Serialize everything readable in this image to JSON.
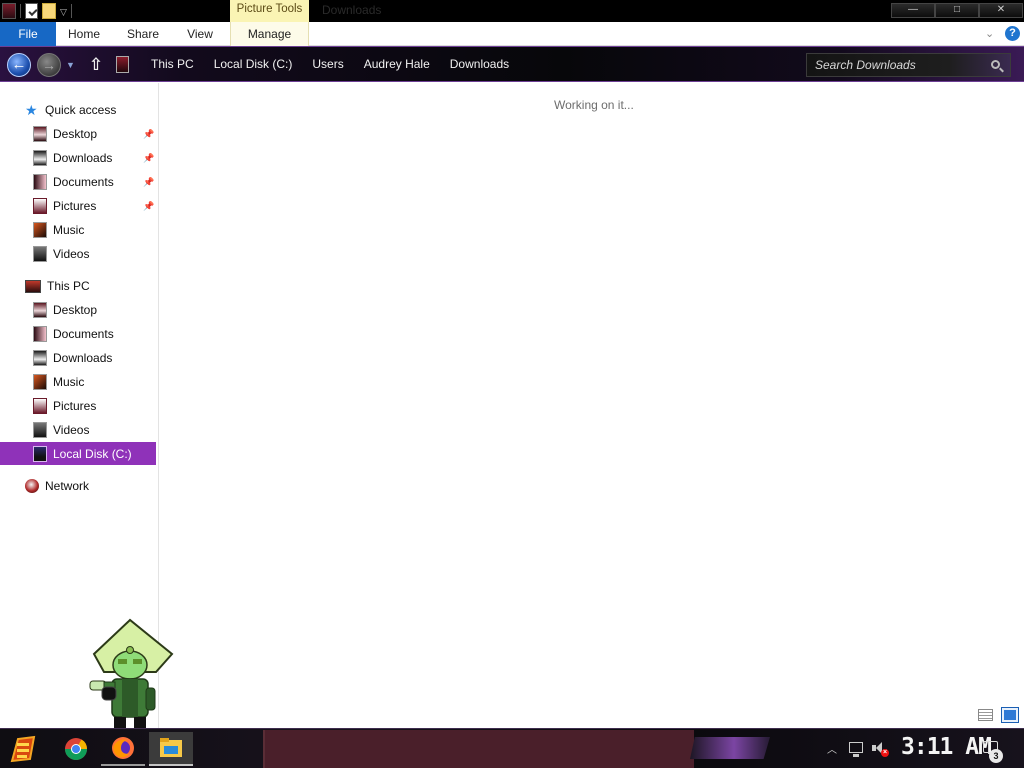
{
  "window": {
    "title": "Downloads",
    "contextual_group": "Picture Tools",
    "controls": {
      "minimize": "—",
      "maximize": "□",
      "close": "✕"
    }
  },
  "ribbon": {
    "tabs": [
      {
        "label": "File"
      },
      {
        "label": "Home"
      },
      {
        "label": "Share"
      },
      {
        "label": "View"
      },
      {
        "label": "Manage"
      }
    ],
    "help": "?"
  },
  "address": {
    "breadcrumbs": [
      "This PC",
      "Local Disk (C:)",
      "Users",
      "Audrey Hale",
      "Downloads"
    ],
    "search_placeholder": "Search Downloads"
  },
  "sidebar": {
    "quick_access": {
      "label": "Quick access",
      "items": [
        {
          "label": "Desktop",
          "icon": "desktop-icon",
          "pinned": true
        },
        {
          "label": "Downloads",
          "icon": "downloads-icon",
          "pinned": true
        },
        {
          "label": "Documents",
          "icon": "documents-icon",
          "pinned": true
        },
        {
          "label": "Pictures",
          "icon": "pictures-icon",
          "pinned": true
        },
        {
          "label": "Music",
          "icon": "music-icon",
          "pinned": false
        },
        {
          "label": "Videos",
          "icon": "videos-icon",
          "pinned": false
        }
      ]
    },
    "this_pc": {
      "label": "This PC",
      "items": [
        {
          "label": "Desktop"
        },
        {
          "label": "Documents"
        },
        {
          "label": "Downloads"
        },
        {
          "label": "Music"
        },
        {
          "label": "Pictures"
        },
        {
          "label": "Videos"
        },
        {
          "label": "Local Disk (C:)",
          "selected": true
        }
      ]
    },
    "network": {
      "label": "Network"
    }
  },
  "content": {
    "status": "Working on it..."
  },
  "taskbar": {
    "clock": "3:11 AM",
    "notification_count": "3",
    "pinned_apps": [
      "chrome-icon",
      "firefox-icon",
      "file-explorer-icon"
    ]
  },
  "colors": {
    "accent_purple": "#8f32b9",
    "ribbon_file_blue": "#1768c5",
    "picture_tools_yellow": "#faf4b4",
    "taskbar_strip": "#4a1f2a"
  }
}
